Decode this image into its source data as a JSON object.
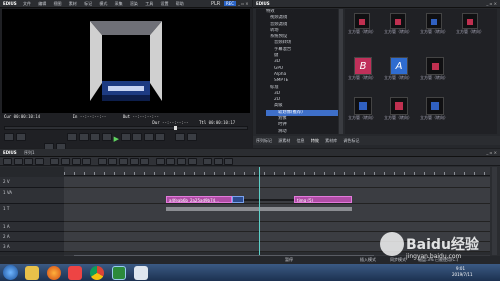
{
  "app": {
    "name": "EDIUS",
    "menu": [
      "文件",
      "编辑",
      "视图",
      "素材",
      "标记",
      "模式",
      "采集",
      "渲染",
      "工具",
      "设置",
      "帮助"
    ],
    "plr_badge": "PLR",
    "rec_badge": "REC"
  },
  "player": {
    "cur_label": "Cur",
    "cur_time": "00:00:10:14",
    "in_label": "In",
    "out_label": "Out",
    "dur_label": "Dur",
    "ttl_label": "Ttl",
    "ttl_time": "00:00:10:17"
  },
  "effects": {
    "title": "EDIUS",
    "tree": [
      "特效",
      "视频滤镜",
      "音频滤镜",
      "转场",
      "系统预设",
      "音频转场",
      "字幕混合",
      "键",
      "3D",
      "GPU",
      "Alpha",
      "SMPTE",
      "标准",
      "3D",
      "2D",
      "高级",
      "软划像(推荐)",
      "划像",
      "时钟",
      "滑动",
      "扭曲",
      "滑像"
    ],
    "selected_index": 16,
    "thumb_label": "立方管（转向）",
    "tabs": [
      "序列标记",
      "源素材",
      "信息",
      "特效",
      "素材库",
      "调色标记"
    ]
  },
  "timeline": {
    "title": "EDIUS",
    "sequence": "序列1",
    "playhead_time": "00:00:10:14",
    "tracks": [
      {
        "name": "2 V",
        "type": "V"
      },
      {
        "name": "1 VA",
        "type": "VA"
      },
      {
        "name": "1 T",
        "type": "T"
      },
      {
        "name": "1 A",
        "type": "A"
      },
      {
        "name": "2 A",
        "type": "A"
      },
      {
        "name": "3 A",
        "type": "A"
      }
    ],
    "clips": [
      {
        "label": "a4feab6b_2a25ad9b74..."
      },
      {
        "label": "timg (5)"
      }
    ]
  },
  "status": {
    "text": "暂停",
    "insert_mode": "插入模式",
    "ripple": "同步模式",
    "disk": "磁盘:3% 已被使用(C:)"
  },
  "taskbar": {
    "time": "9:01",
    "date": "2019/7/11",
    "icons": [
      "start-icon",
      "explorer-icon",
      "firefox-icon",
      "media-player-icon",
      "chrome-icon",
      "edius-icon",
      "file-icon"
    ]
  },
  "watermark": {
    "text": "Baidu经验",
    "url": "jingyan.baidu.com"
  }
}
